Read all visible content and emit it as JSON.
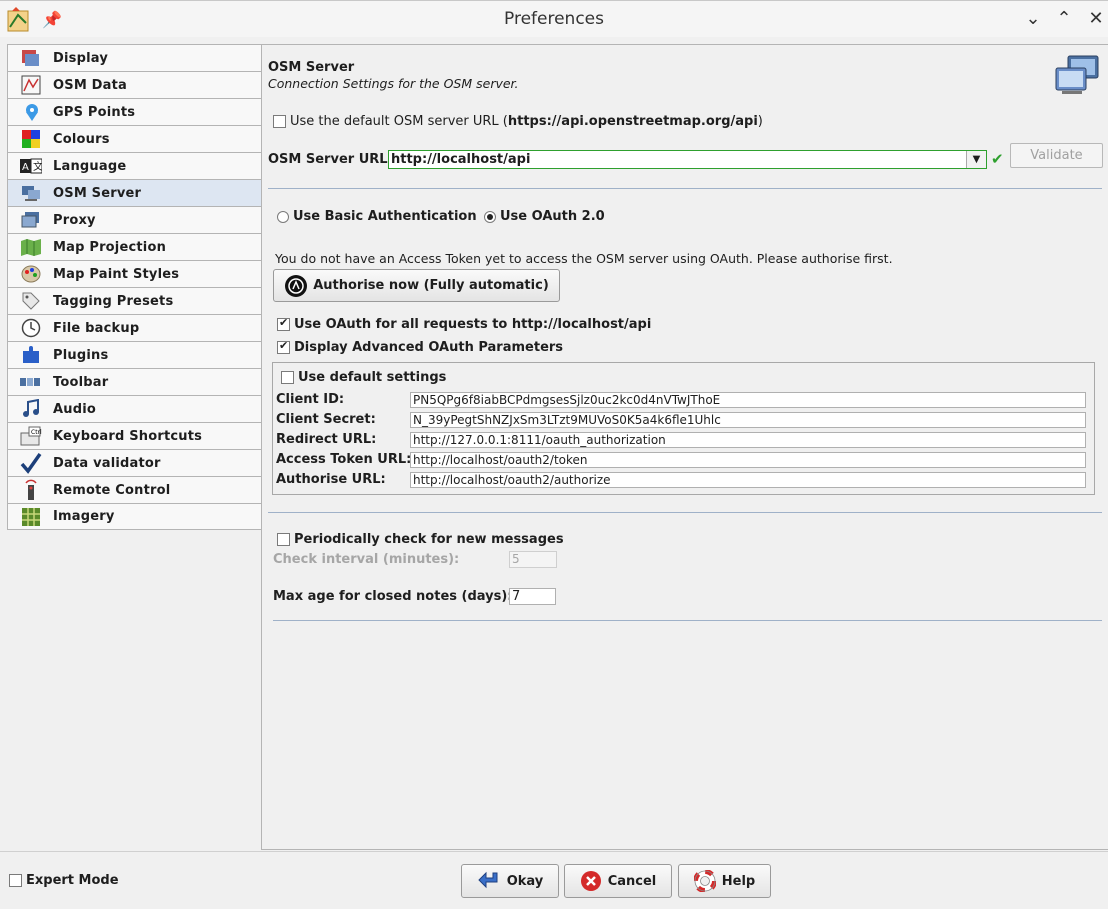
{
  "window": {
    "title": "Preferences"
  },
  "sidebar": {
    "items": [
      {
        "label": "Display",
        "icon": "display-icon"
      },
      {
        "label": "OSM Data",
        "icon": "osm-data-icon"
      },
      {
        "label": "GPS Points",
        "icon": "gps-points-icon"
      },
      {
        "label": "Colours",
        "icon": "colours-icon"
      },
      {
        "label": "Language",
        "icon": "language-icon"
      },
      {
        "label": "OSM Server",
        "icon": "osm-server-icon",
        "selected": true
      },
      {
        "label": "Proxy",
        "icon": "proxy-icon"
      },
      {
        "label": "Map Projection",
        "icon": "map-projection-icon"
      },
      {
        "label": "Map Paint Styles",
        "icon": "map-paint-styles-icon"
      },
      {
        "label": "Tagging Presets",
        "icon": "tagging-presets-icon"
      },
      {
        "label": "File backup",
        "icon": "file-backup-icon"
      },
      {
        "label": "Plugins",
        "icon": "plugins-icon"
      },
      {
        "label": "Toolbar",
        "icon": "toolbar-icon"
      },
      {
        "label": "Audio",
        "icon": "audio-icon"
      },
      {
        "label": "Keyboard Shortcuts",
        "icon": "keyboard-shortcuts-icon"
      },
      {
        "label": "Data validator",
        "icon": "data-validator-icon"
      },
      {
        "label": "Remote Control",
        "icon": "remote-control-icon"
      },
      {
        "label": "Imagery",
        "icon": "imagery-icon"
      }
    ]
  },
  "header": {
    "title": "OSM Server",
    "description": "Connection Settings for the OSM server."
  },
  "server": {
    "default_url_prefix": "Use the default OSM server URL (",
    "default_url": "https://api.openstreetmap.org/api",
    "default_url_suffix": ")",
    "url_label": "OSM Server URL:",
    "url_value": "http://localhost/api",
    "validate_label": "Validate"
  },
  "auth": {
    "basic_label": "Use Basic Authentication",
    "oauth_label": "Use OAuth 2.0",
    "selected": "oauth",
    "notice": "You do not have an Access Token yet to access the OSM server using OAuth. Please authorise first.",
    "authorise_label": "Authorise now (Fully automatic)",
    "oauth_all_requests_label": "Use OAuth for all requests to http://localhost/api",
    "oauth_all_requests_checked": true,
    "advanced_label": "Display Advanced OAuth Parameters",
    "advanced_checked": true
  },
  "advanced": {
    "default_settings_label": "Use default settings",
    "default_settings_checked": false,
    "client_id_label": "Client ID:",
    "client_id_value": "PN5QPg6f8iabBCPdmgsesSjlz0uc2kc0d4nVTwJThoE",
    "client_secret_label": "Client Secret:",
    "client_secret_value": "N_39yPegtShNZJxSm3LTzt9MUVoS0K5a4k6fle1Uhlc",
    "redirect_url_label": "Redirect URL:",
    "redirect_url_value": "http://127.0.0.1:8111/oauth_authorization",
    "access_token_url_label": "Access Token URL:",
    "access_token_url_value": "http://localhost/oauth2/token",
    "authorise_url_label": "Authorise URL:",
    "authorise_url_value": "http://localhost/oauth2/authorize"
  },
  "messages": {
    "periodic_label": "Periodically check for new messages",
    "periodic_checked": false,
    "interval_label": "Check interval (minutes):",
    "interval_value": "5",
    "max_age_label": "Max age for closed notes (days):",
    "max_age_value": "7"
  },
  "footer": {
    "expert_mode_label": "Expert Mode",
    "okay_label": "Okay",
    "cancel_label": "Cancel",
    "help_label": "Help"
  },
  "colors": {
    "accent_green": "#2ea02e",
    "selected_tab": "#dde6f2",
    "separator": "#9fb1c8"
  }
}
